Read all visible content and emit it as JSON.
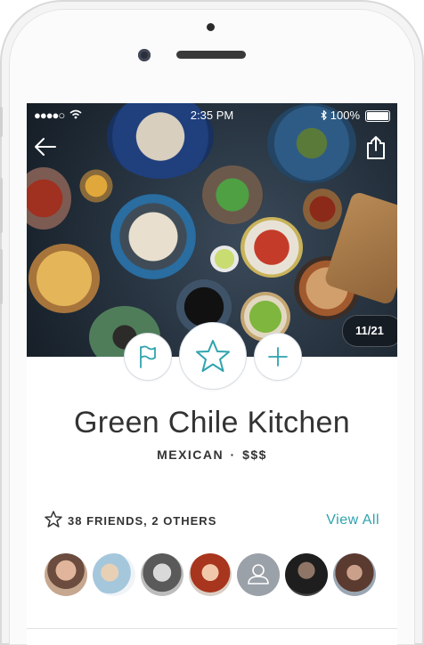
{
  "status_bar": {
    "signal": "●●●●○",
    "time": "2:35 PM",
    "battery": "100%"
  },
  "gallery": {
    "counter": "11/21"
  },
  "icons": {
    "back": "arrow-left-icon",
    "share": "share-icon",
    "flag": "flag-icon",
    "star": "star-icon",
    "add": "plus-icon",
    "friends": "star-outline-icon",
    "placeholder_avatar": "user-icon"
  },
  "restaurant": {
    "name": "Green Chile Kitchen",
    "cuisine": "MEXICAN",
    "separator": "·",
    "price": "$$$"
  },
  "friends": {
    "summary": "38 FRIENDS, 2 OTHERS",
    "view_all_label": "View All",
    "avatars": [
      {
        "type": "photo",
        "color": "#b98e74"
      },
      {
        "type": "photo",
        "color": "#9bb7c9"
      },
      {
        "type": "photo",
        "color": "#7d7d7d"
      },
      {
        "type": "photo",
        "color": "#b04a30"
      },
      {
        "type": "placeholder",
        "color": "#9ba1a8"
      },
      {
        "type": "photo",
        "color": "#3a3a3a"
      },
      {
        "type": "photo",
        "color": "#6e4a3e"
      }
    ]
  },
  "colors": {
    "accent": "#2fa3ae",
    "title_text": "#333333",
    "action_border": "#d5dde2"
  }
}
